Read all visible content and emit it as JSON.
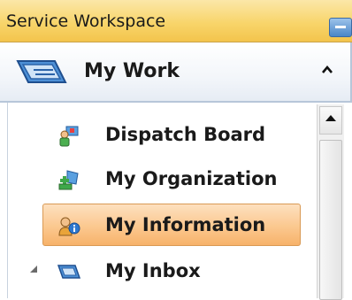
{
  "window": {
    "title": "Service Workspace"
  },
  "section": {
    "label": "My Work",
    "collapse_icon": "chevron-up-icon"
  },
  "items": [
    {
      "label": "Dispatch Board",
      "icon": "dispatch-board-icon",
      "selected": false
    },
    {
      "label": "My Organization",
      "icon": "organization-icon",
      "selected": false
    },
    {
      "label": "My Information",
      "icon": "user-info-icon",
      "selected": true
    },
    {
      "label": "My Inbox",
      "icon": "inbox-icon",
      "selected": false,
      "expandable": true
    }
  ],
  "colors": {
    "titlebar": "#f8d56b",
    "selected": "#fbc88f",
    "accent": "#3b6aa3"
  }
}
